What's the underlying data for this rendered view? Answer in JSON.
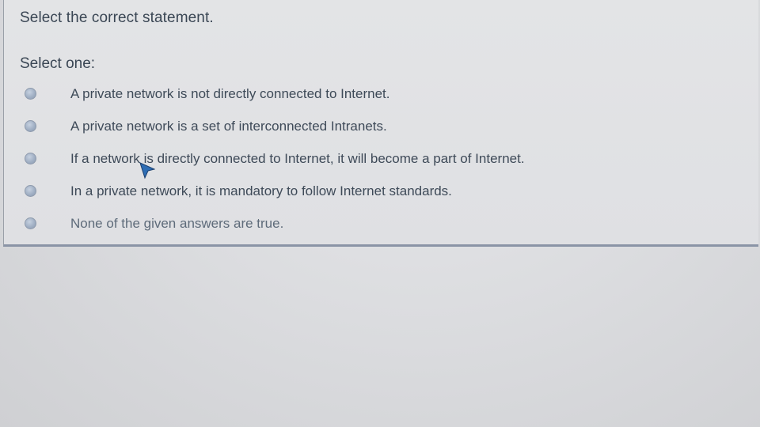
{
  "question": {
    "text": "Select the correct statement.",
    "select_label": "Select one:",
    "options": [
      {
        "label": "A private network is not directly connected to Internet.",
        "selected": false
      },
      {
        "label": "A private network is a set of interconnected Intranets.",
        "selected": false
      },
      {
        "label": "If a network is directly connected to Internet, it will become a part of Internet.",
        "selected": false
      },
      {
        "label": "In a private network, it is mandatory to follow Internet standards.",
        "selected": false
      },
      {
        "label": "None of the given answers are true.",
        "selected": false
      }
    ]
  },
  "colors": {
    "text": "#3a4654",
    "radio": "#9eadc2",
    "panel_border": "#8a94a6",
    "cursor": "#2e6db4"
  },
  "icons": {
    "cursor": "mouse-pointer-icon"
  }
}
